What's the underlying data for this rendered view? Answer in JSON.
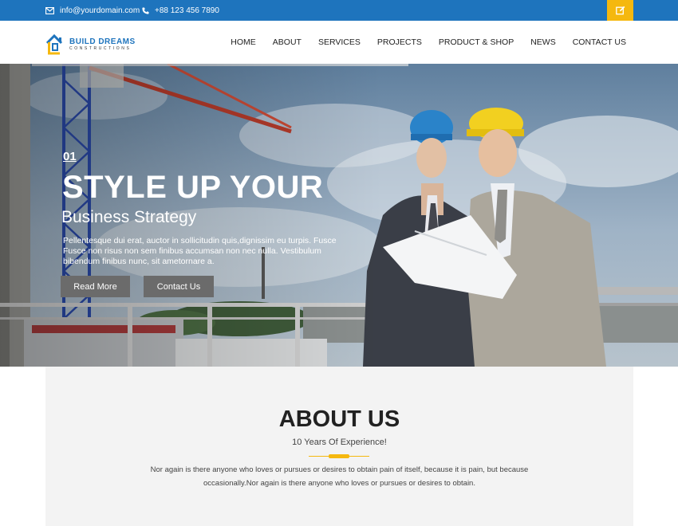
{
  "topbar": {
    "email": "info@yourdomain.com",
    "phone": "+88 123 456 7890",
    "email_icon": "envelope-icon",
    "phone_icon": "phone-icon",
    "edit_icon": "pencil-square-icon",
    "bg_color": "#1e74bd",
    "accent_color": "#f5b80f"
  },
  "header": {
    "logo_title": "BUILD DREAMS",
    "logo_subtitle": "CONSTRUCTIONS",
    "logo_icon": "house-logo-icon",
    "nav": [
      "HOME",
      "ABOUT",
      "SERVICES",
      "PROJECTS",
      "PRODUCT & SHOP",
      "NEWS",
      "CONTACT US"
    ]
  },
  "hero": {
    "slide_number": "01",
    "headline": "STYLE UP YOUR",
    "subheadline": "Business Strategy",
    "body": "Pellentesque dui erat, auctor in sollicitudin quis,dignissim eu turpis. Fusce Fusce non risus non sem finibus accumsan non nec nulla. Vestibulum bibendum finibus nunc, sit ametornare a.",
    "read_more": "Read More",
    "contact_us": "Contact Us"
  },
  "about": {
    "title": "ABOUT US",
    "tagline": "10 Years Of Experience!",
    "text": "Nor again is there anyone who loves or pursues or desires to obtain pain of itself, because it is pain, but because occasionally.Nor again is there anyone who loves or pursues or desires to obtain."
  }
}
